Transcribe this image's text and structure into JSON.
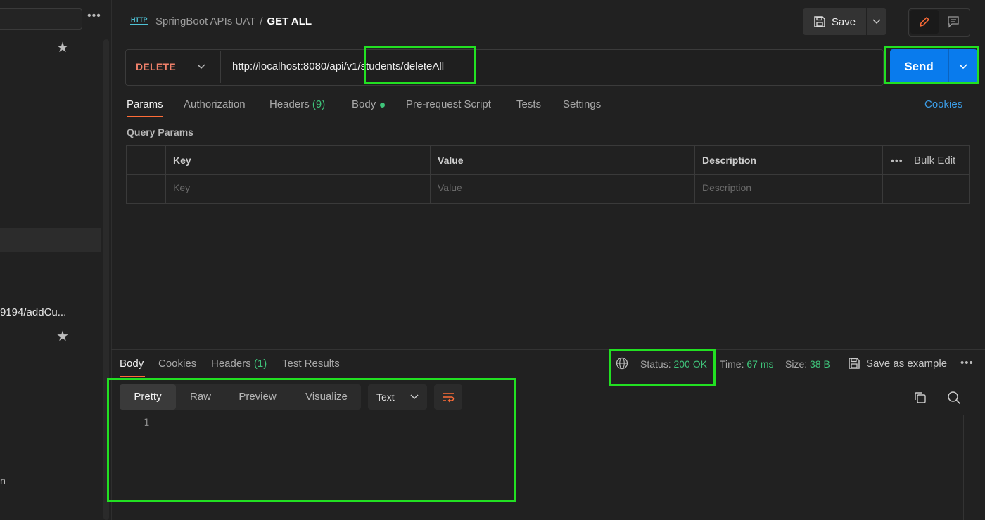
{
  "sidebar": {
    "item_text": "9194/addCu...",
    "item_partial": "n",
    "more": "•••",
    "star": "★"
  },
  "header": {
    "icon_text": "HTTP",
    "collection": "SpringBoot APIs UAT",
    "separator": "/",
    "request_name": "GET ALL",
    "save_label": "Save"
  },
  "request": {
    "method": "DELETE",
    "url": "http://localhost:8080/api/v1/students/deleteAll",
    "send_label": "Send",
    "method_color": "#f0806a",
    "send_color": "#097bed"
  },
  "request_tabs": {
    "params": "Params",
    "authorization": "Authorization",
    "headers": "Headers",
    "headers_count": "(9)",
    "body": "Body",
    "pre_request": "Pre-request Script",
    "tests": "Tests",
    "settings": "Settings",
    "cookies": "Cookies"
  },
  "query_params": {
    "title": "Query Params",
    "columns": [
      "Key",
      "Value",
      "Description"
    ],
    "placeholders": [
      "Key",
      "Value",
      "Description"
    ],
    "more": "•••",
    "bulk_edit": "Bulk Edit"
  },
  "response": {
    "tabs": {
      "body": "Body",
      "cookies": "Cookies",
      "headers": "Headers",
      "headers_count": "(1)",
      "test_results": "Test Results"
    },
    "status_label": "Status:",
    "status_value": "200 OK",
    "time_label": "Time:",
    "time_value": "67 ms",
    "size_label": "Size:",
    "size_value": "38 B",
    "save_example": "Save as example",
    "more": "•••",
    "views": [
      "Pretty",
      "Raw",
      "Preview",
      "Visualize"
    ],
    "format": "Text",
    "line_number": "1"
  },
  "highlight_color": "#22e022"
}
